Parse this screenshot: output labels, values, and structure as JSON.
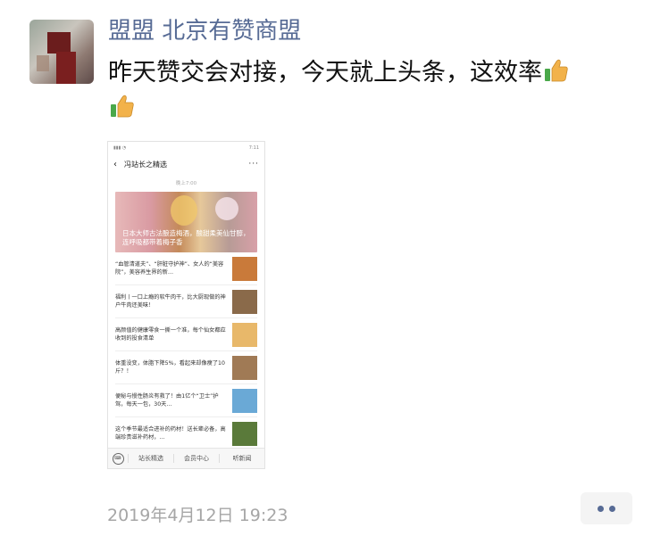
{
  "author": "盟盟 北京有赞商盟",
  "post_text": "昨天赞交会对接，今天就上头条，这效率",
  "emoji": "thumbs-up-icon",
  "screenshot": {
    "status_time": "7:11",
    "nav_title": "冯站长之精选",
    "time_label": "晚上7:00",
    "hero_text": "日本大师古法酿造梅酒，酸甜柔美仙甘醇，连呼吸都带着梅子香",
    "items": [
      {
        "text": "“血管清道夫”、“肝脏守护神”、女人的“美容院”，美容养生界的新…",
        "color": "#c97a3a"
      },
      {
        "text": "福利丨一口上瘾的软牛肉干，比大厨现做的神户牛肉还美味！",
        "color": "#8a6a4a"
      },
      {
        "text": "高颜值的健康零食一撕一个准，每个仙女都应收到的投食清单",
        "color": "#e8b86a"
      },
      {
        "text": "体重没变，体脂下降5%，看起来却像瘦了10斤？！",
        "color": "#a07a55"
      },
      {
        "text": "便秘与慢性肠炎有救了！由1亿个“卫士”护驾，每天一包，30天…",
        "color": "#6aa9d6"
      },
      {
        "text": "这个季节最适合进补的药材！送长辈必备，高端珍贵滋补药材，…",
        "color": "#5a7a3a"
      }
    ],
    "tabs": [
      "站长精选",
      "会员中心",
      "听新闻"
    ]
  },
  "timestamp": "2019年4月12日 19:23"
}
